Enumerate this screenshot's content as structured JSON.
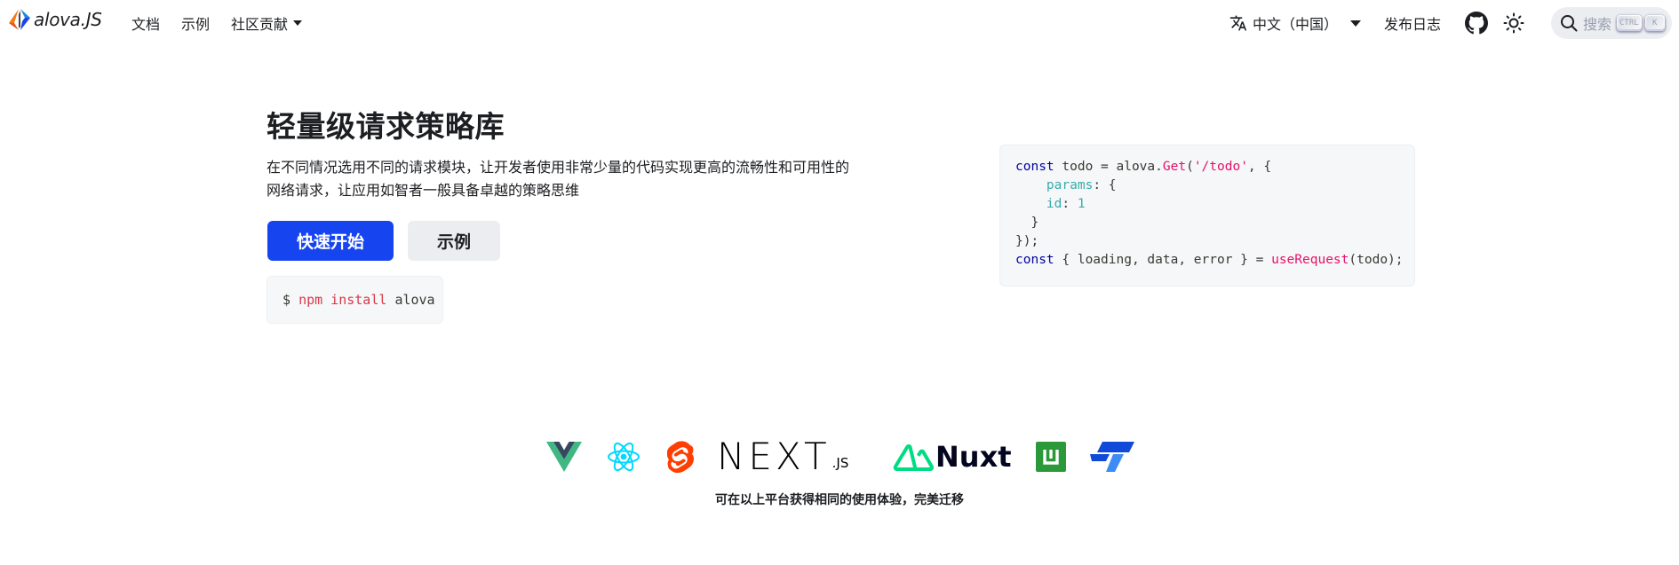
{
  "brand": {
    "name": "alova.JS"
  },
  "nav": {
    "docs": "文档",
    "examples": "示例",
    "community": "社区贡献",
    "language": "中文（中国）",
    "releases": "发布日志"
  },
  "search": {
    "placeholder": "搜索",
    "key_ctrl": "CTRL",
    "key_k": "K"
  },
  "hero": {
    "title": "轻量级请求策略库",
    "description": "在不同情况选用不同的请求模块，让开发者使用非常少量的代码实现更高的流畅性和可用性的网络请求，让应用如智者一般具备卓越的策略思维",
    "primary_button": "快速开始",
    "secondary_button": "示例",
    "install": {
      "prompt": "$",
      "cmd": "npm install",
      "pkg": "alova"
    }
  },
  "code": {
    "l1_const": "const",
    "l1_todo": " todo = alova.",
    "l1_get": "Get",
    "l1_paren": "(",
    "l1_str": "'/todo'",
    "l1_tail": ", {",
    "l2_params": "params",
    "l2_tail": ": {",
    "l3_id": "id",
    "l3_colon": ": ",
    "l3_num": "1",
    "l4": "  }",
    "l5": "});",
    "l6_const": "const",
    "l6_mid": " { loading, data, error } = ",
    "l6_fn": "useRequest",
    "l6_tail": "(todo);"
  },
  "logos": {
    "icons": [
      "vue-icon",
      "react-icon",
      "svelte-icon",
      "nextjs-logo",
      "nuxt-logo",
      "uniapp-icon",
      "taro-icon"
    ],
    "next_text": "NEXT",
    "next_suffix": ".JS",
    "nuxt_text": "Nuxt",
    "caption": "可在以上平台获得相同的使用体验，完美迁移"
  },
  "colors": {
    "primary": "#1645f0",
    "secondary_bg": "#ebedf0",
    "code_bg": "#f6f7f8",
    "vue_green": "#41b883",
    "vue_dark": "#35495e",
    "react_cyan": "#00d8ff",
    "svelte_orange": "#ff3e00",
    "nuxt_green": "#00dc82",
    "uniapp_green": "#2b9939",
    "taro_blue": "#0f4ad8"
  }
}
